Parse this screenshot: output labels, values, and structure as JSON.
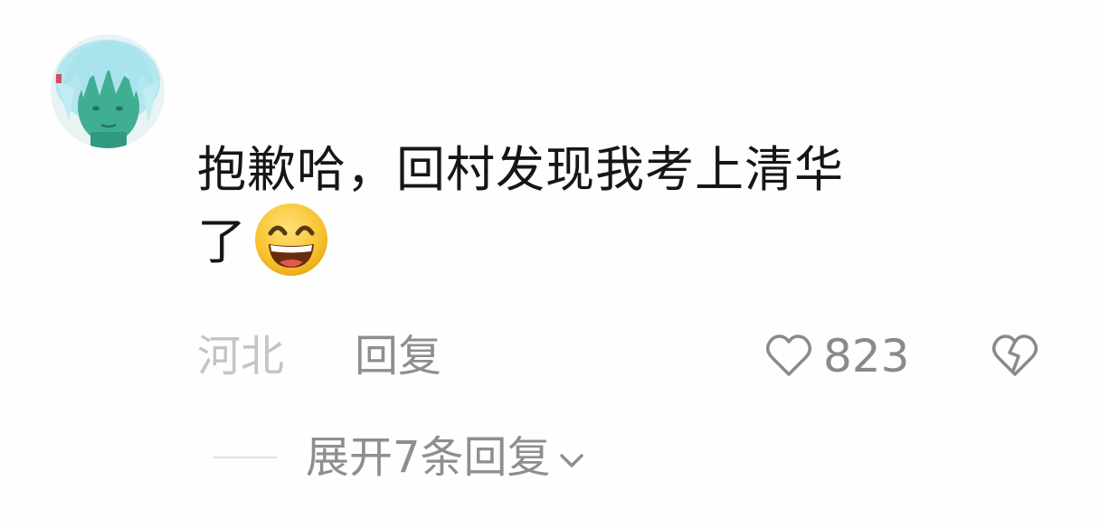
{
  "comment": {
    "text_line1": "抱歉哈，回村发现我考上清华",
    "text_line2": "了",
    "emoji": "grinning-face-emoji",
    "location": "河北",
    "reply_label": "回复",
    "like_count": "823",
    "expand_label": "展开7条回复"
  },
  "icons": {
    "like": "heart-outline-icon",
    "dislike": "broken-heart-icon",
    "expand": "chevron-down-icon"
  },
  "colors": {
    "background": "#fefefe",
    "primary_text": "#161616",
    "secondary_text": "#8e8e8e",
    "location_text": "#c4c4c4",
    "avatar_skin": "#3fae92",
    "avatar_hair": "#a9e3ee"
  }
}
